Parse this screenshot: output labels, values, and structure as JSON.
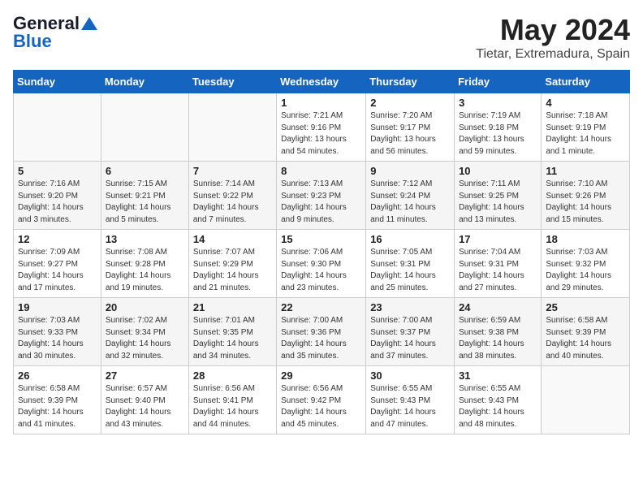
{
  "header": {
    "logo_general": "General",
    "logo_blue": "Blue",
    "title": "May 2024",
    "subtitle": "Tietar, Extremadura, Spain"
  },
  "calendar": {
    "days_of_week": [
      "Sunday",
      "Monday",
      "Tuesday",
      "Wednesday",
      "Thursday",
      "Friday",
      "Saturday"
    ],
    "weeks": [
      [
        {
          "day": "",
          "info": ""
        },
        {
          "day": "",
          "info": ""
        },
        {
          "day": "",
          "info": ""
        },
        {
          "day": "1",
          "info": "Sunrise: 7:21 AM\nSunset: 9:16 PM\nDaylight: 13 hours and 54 minutes."
        },
        {
          "day": "2",
          "info": "Sunrise: 7:20 AM\nSunset: 9:17 PM\nDaylight: 13 hours and 56 minutes."
        },
        {
          "day": "3",
          "info": "Sunrise: 7:19 AM\nSunset: 9:18 PM\nDaylight: 13 hours and 59 minutes."
        },
        {
          "day": "4",
          "info": "Sunrise: 7:18 AM\nSunset: 9:19 PM\nDaylight: 14 hours and 1 minute."
        }
      ],
      [
        {
          "day": "5",
          "info": "Sunrise: 7:16 AM\nSunset: 9:20 PM\nDaylight: 14 hours and 3 minutes."
        },
        {
          "day": "6",
          "info": "Sunrise: 7:15 AM\nSunset: 9:21 PM\nDaylight: 14 hours and 5 minutes."
        },
        {
          "day": "7",
          "info": "Sunrise: 7:14 AM\nSunset: 9:22 PM\nDaylight: 14 hours and 7 minutes."
        },
        {
          "day": "8",
          "info": "Sunrise: 7:13 AM\nSunset: 9:23 PM\nDaylight: 14 hours and 9 minutes."
        },
        {
          "day": "9",
          "info": "Sunrise: 7:12 AM\nSunset: 9:24 PM\nDaylight: 14 hours and 11 minutes."
        },
        {
          "day": "10",
          "info": "Sunrise: 7:11 AM\nSunset: 9:25 PM\nDaylight: 14 hours and 13 minutes."
        },
        {
          "day": "11",
          "info": "Sunrise: 7:10 AM\nSunset: 9:26 PM\nDaylight: 14 hours and 15 minutes."
        }
      ],
      [
        {
          "day": "12",
          "info": "Sunrise: 7:09 AM\nSunset: 9:27 PM\nDaylight: 14 hours and 17 minutes."
        },
        {
          "day": "13",
          "info": "Sunrise: 7:08 AM\nSunset: 9:28 PM\nDaylight: 14 hours and 19 minutes."
        },
        {
          "day": "14",
          "info": "Sunrise: 7:07 AM\nSunset: 9:29 PM\nDaylight: 14 hours and 21 minutes."
        },
        {
          "day": "15",
          "info": "Sunrise: 7:06 AM\nSunset: 9:30 PM\nDaylight: 14 hours and 23 minutes."
        },
        {
          "day": "16",
          "info": "Sunrise: 7:05 AM\nSunset: 9:31 PM\nDaylight: 14 hours and 25 minutes."
        },
        {
          "day": "17",
          "info": "Sunrise: 7:04 AM\nSunset: 9:31 PM\nDaylight: 14 hours and 27 minutes."
        },
        {
          "day": "18",
          "info": "Sunrise: 7:03 AM\nSunset: 9:32 PM\nDaylight: 14 hours and 29 minutes."
        }
      ],
      [
        {
          "day": "19",
          "info": "Sunrise: 7:03 AM\nSunset: 9:33 PM\nDaylight: 14 hours and 30 minutes."
        },
        {
          "day": "20",
          "info": "Sunrise: 7:02 AM\nSunset: 9:34 PM\nDaylight: 14 hours and 32 minutes."
        },
        {
          "day": "21",
          "info": "Sunrise: 7:01 AM\nSunset: 9:35 PM\nDaylight: 14 hours and 34 minutes."
        },
        {
          "day": "22",
          "info": "Sunrise: 7:00 AM\nSunset: 9:36 PM\nDaylight: 14 hours and 35 minutes."
        },
        {
          "day": "23",
          "info": "Sunrise: 7:00 AM\nSunset: 9:37 PM\nDaylight: 14 hours and 37 minutes."
        },
        {
          "day": "24",
          "info": "Sunrise: 6:59 AM\nSunset: 9:38 PM\nDaylight: 14 hours and 38 minutes."
        },
        {
          "day": "25",
          "info": "Sunrise: 6:58 AM\nSunset: 9:39 PM\nDaylight: 14 hours and 40 minutes."
        }
      ],
      [
        {
          "day": "26",
          "info": "Sunrise: 6:58 AM\nSunset: 9:39 PM\nDaylight: 14 hours and 41 minutes."
        },
        {
          "day": "27",
          "info": "Sunrise: 6:57 AM\nSunset: 9:40 PM\nDaylight: 14 hours and 43 minutes."
        },
        {
          "day": "28",
          "info": "Sunrise: 6:56 AM\nSunset: 9:41 PM\nDaylight: 14 hours and 44 minutes."
        },
        {
          "day": "29",
          "info": "Sunrise: 6:56 AM\nSunset: 9:42 PM\nDaylight: 14 hours and 45 minutes."
        },
        {
          "day": "30",
          "info": "Sunrise: 6:55 AM\nSunset: 9:43 PM\nDaylight: 14 hours and 47 minutes."
        },
        {
          "day": "31",
          "info": "Sunrise: 6:55 AM\nSunset: 9:43 PM\nDaylight: 14 hours and 48 minutes."
        },
        {
          "day": "",
          "info": ""
        }
      ]
    ]
  }
}
